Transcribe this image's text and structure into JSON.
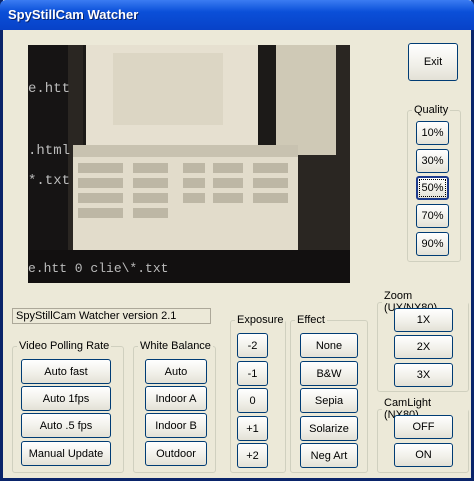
{
  "window": {
    "title": "SpyStillCam Watcher"
  },
  "buttons": {
    "exit": "Exit"
  },
  "version_text": "SpyStillCam Watcher version 2.1",
  "quality": {
    "label": "Quality",
    "options": [
      "10%",
      "30%",
      "50%",
      "70%",
      "90%"
    ],
    "selected": "50%"
  },
  "video_polling": {
    "label": "Video Polling Rate",
    "options": [
      "Auto fast",
      "Auto 1fps",
      "Auto .5 fps",
      "Manual Update"
    ]
  },
  "white_balance": {
    "label": "White Balance",
    "options": [
      "Auto",
      "Indoor A",
      "Indoor B",
      "Outdoor"
    ]
  },
  "exposure": {
    "label": "Exposure",
    "options": [
      "-2",
      "-1",
      "0",
      "+1",
      "+2"
    ]
  },
  "effect": {
    "label": "Effect",
    "options": [
      "None",
      "B&W",
      "Sepia",
      "Solarize",
      "Neg Art"
    ]
  },
  "zoom": {
    "label": "Zoom (UX/NX80)",
    "options": [
      "1X",
      "2X",
      "3X"
    ]
  },
  "camlight": {
    "label": "CamLight (NX80)",
    "options": [
      "OFF",
      "ON"
    ]
  },
  "camera_feed": {
    "lines": [
      "e.htt",
      ".html",
      "*.txt",
      "e.htt 0 clie\\*.txt"
    ]
  },
  "colors": {
    "title_bar": "#0a4fd8",
    "window_bg": "#ece9d8",
    "button_border": "#003c74"
  }
}
